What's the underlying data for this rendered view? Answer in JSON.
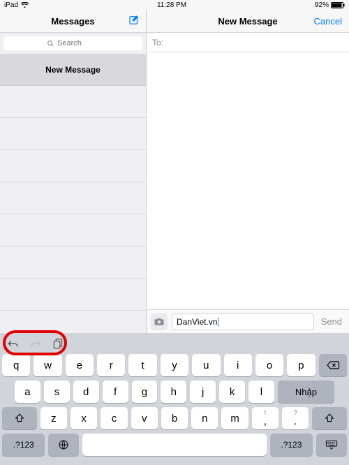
{
  "statusbar": {
    "device": "iPad",
    "time": "11:28 PM",
    "battery_pct": "92%"
  },
  "sidebar": {
    "title": "Messages",
    "search_placeholder": "Search",
    "items": [
      {
        "title": "New Message",
        "selected": true
      }
    ]
  },
  "detail": {
    "title": "New Message",
    "cancel_label": "Cancel",
    "to_label": "To:",
    "input_value": "DanViet.vn",
    "send_label": "Send"
  },
  "keyboard": {
    "rows": [
      [
        "q",
        "w",
        "e",
        "r",
        "t",
        "y",
        "u",
        "i",
        "o",
        "p"
      ],
      [
        "a",
        "s",
        "d",
        "f",
        "g",
        "h",
        "j",
        "k",
        "l"
      ],
      [
        "z",
        "x",
        "c",
        "v",
        "b",
        "n",
        "m",
        ",",
        "!",
        "?",
        "."
      ]
    ],
    "enter_label": "Nhập",
    "numbers_label": ".?123",
    "punct_upper": {
      "comma": "!",
      "period": "?"
    }
  }
}
